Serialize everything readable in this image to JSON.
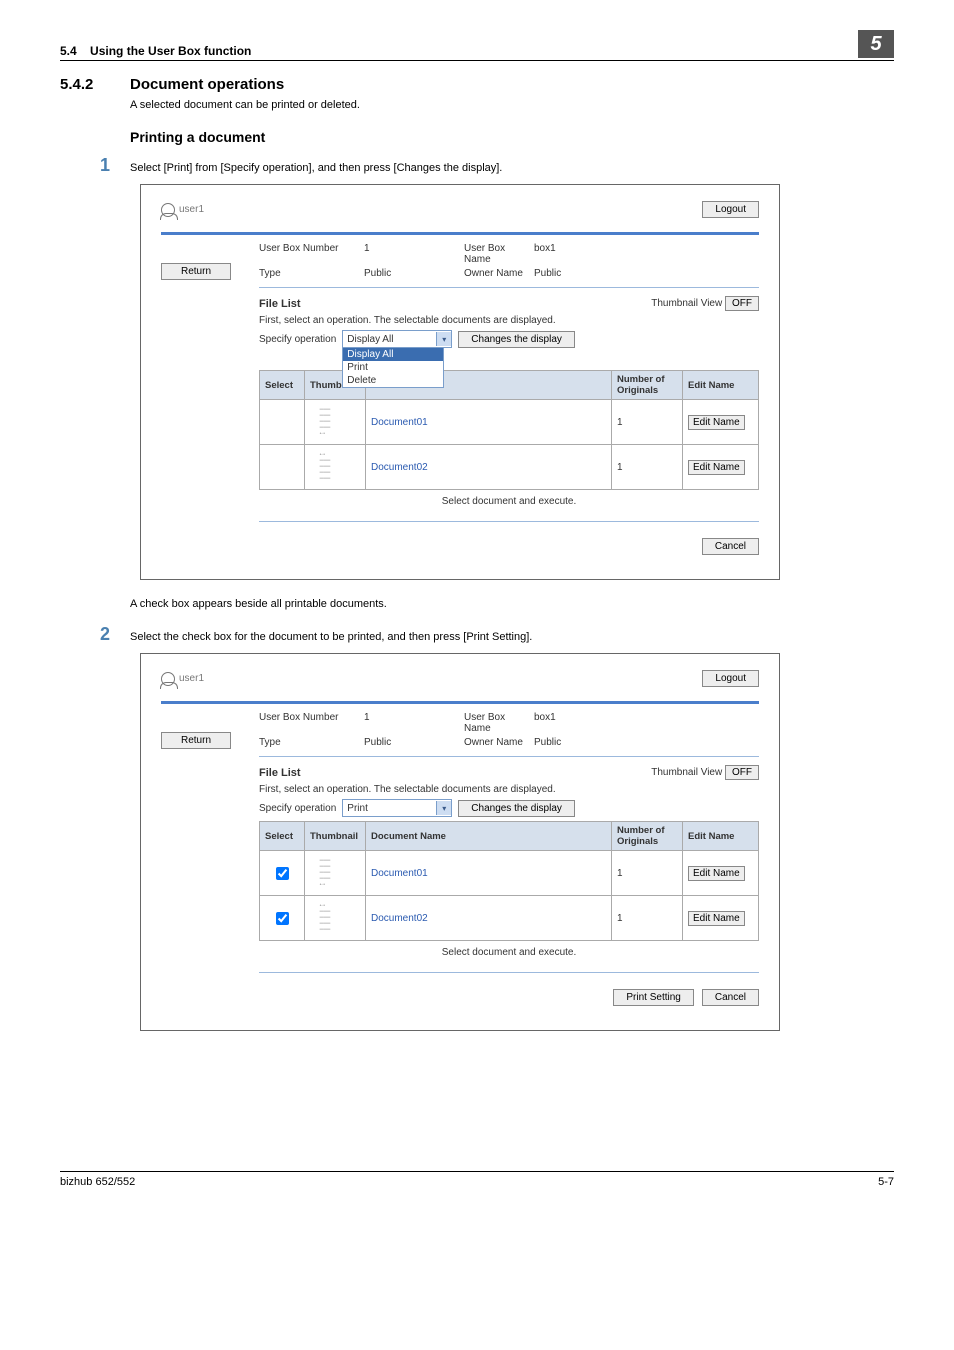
{
  "header": {
    "section_num": "5.4",
    "section_title": "Using the User Box function",
    "chapter": "5"
  },
  "sec": {
    "num": "5.4.2",
    "title": "Document operations",
    "intro": "A selected document can be printed or deleted."
  },
  "sub": {
    "title": "Printing a document",
    "step1_num": "1",
    "step1_text": "Select [Print] from [Specify operation], and then press [Changes the display].",
    "after1": "A check box appears beside all printable documents.",
    "step2_num": "2",
    "step2_text": "Select the check box for the document to be printed, and then press [Print Setting]."
  },
  "shot": {
    "user": "user1",
    "logout": "Logout",
    "return": "Return",
    "userbox_num_l": "User Box Number",
    "userbox_num_v": "1",
    "userbox_name_l": "User Box Name",
    "userbox_name_v": "box1",
    "type_l": "Type",
    "type_v": "Public",
    "owner_l": "Owner Name",
    "owner_v": "Public",
    "filelist": "File List",
    "thumbview": "Thumbnail View",
    "off": "OFF",
    "helper": "First, select an operation. The selectable documents are displayed.",
    "specify": "Specify operation",
    "display_all": "Display All",
    "print": "Print",
    "delete": "Delete",
    "changes": "Changes the display",
    "cols": {
      "select": "Select",
      "thumb": "Thumbnail",
      "docname": "Document Name",
      "numorig": "Number of Originals",
      "editname": "Edit Name"
    },
    "doc1": "Document01",
    "doc2": "Document02",
    "one": "1",
    "editname_btn": "Edit Name",
    "selexec": "Select document and execute.",
    "cancel": "Cancel",
    "print_setting": "Print Setting"
  },
  "footer": {
    "left": "bizhub 652/552",
    "right": "5-7"
  }
}
